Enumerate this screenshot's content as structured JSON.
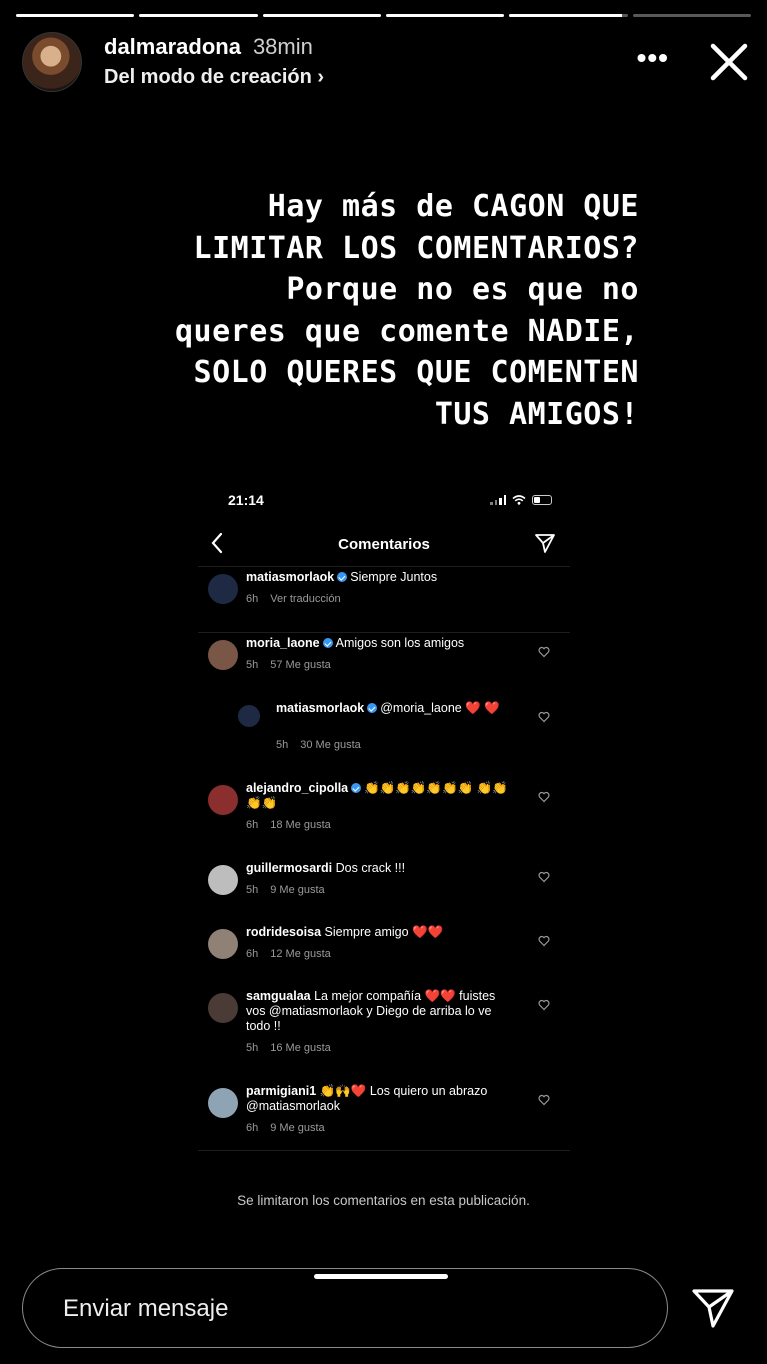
{
  "progress": [
    1,
    1,
    1,
    1,
    0.95,
    0
  ],
  "header": {
    "username": "dalmaradona",
    "time": "38min",
    "subline": "Del modo de creación ›",
    "more_label": "•••"
  },
  "story_text": [
    "Hay más de CAGON QUE",
    "LIMITAR LOS COMENTARIOS?",
    "Porque no es que no",
    "queres que comente NADIE,",
    "SOLO QUERES QUE COMENTEN",
    "TUS AMIGOS!"
  ],
  "screenshot": {
    "clock": "21:14",
    "title": "Comentarios",
    "comments": [
      {
        "user": "matiasmorlaok",
        "verified": true,
        "text": "Siempre Juntos",
        "time": "6h",
        "action": "Ver traducción",
        "likes": "",
        "color": "#1e2a44"
      },
      {
        "user": "moria_laone",
        "verified": true,
        "text": "Amigos son los amigos",
        "time": "5h",
        "action": "",
        "likes": "57 Me gusta",
        "color": "#7a5646"
      },
      {
        "user": "matiasmorlaok",
        "verified": true,
        "text": "@moria_laone ❤️ ❤️",
        "time": "5h",
        "action": "",
        "likes": "30 Me gusta",
        "color": "#1e2a44"
      },
      {
        "user": "alejandro_cipolla",
        "verified": true,
        "text": "👏👏👏👏👏👏👏 👏👏👏👏",
        "time": "6h",
        "action": "",
        "likes": "18 Me gusta",
        "color": "#8a2e2e"
      },
      {
        "user": "guillermosardi",
        "verified": false,
        "text": "Dos crack !!!",
        "time": "5h",
        "action": "",
        "likes": "9 Me gusta",
        "color": "#bdbdbd"
      },
      {
        "user": "rodridesoisa",
        "verified": false,
        "text": "Siempre amigo ❤️❤️",
        "time": "6h",
        "action": "",
        "likes": "12 Me gusta",
        "color": "#8f8175"
      },
      {
        "user": "samgualaa",
        "verified": false,
        "text": "La mejor compañía ❤️❤️ fuistes vos @matiasmorlaok  y Diego de arriba lo ve todo !!",
        "time": "5h",
        "action": "",
        "likes": "16 Me gusta",
        "color": "#4a3b36"
      },
      {
        "user": "parmigiani1",
        "verified": false,
        "text": "👏🙌❤️ Los quiero un abrazo @matiasmorlaok",
        "time": "6h",
        "action": "",
        "likes": "9 Me gusta",
        "color": "#8ea3b4"
      }
    ],
    "limited_note": "Se limitaron los comentarios en esta publicación."
  },
  "reply": {
    "placeholder": "Enviar mensaje"
  }
}
